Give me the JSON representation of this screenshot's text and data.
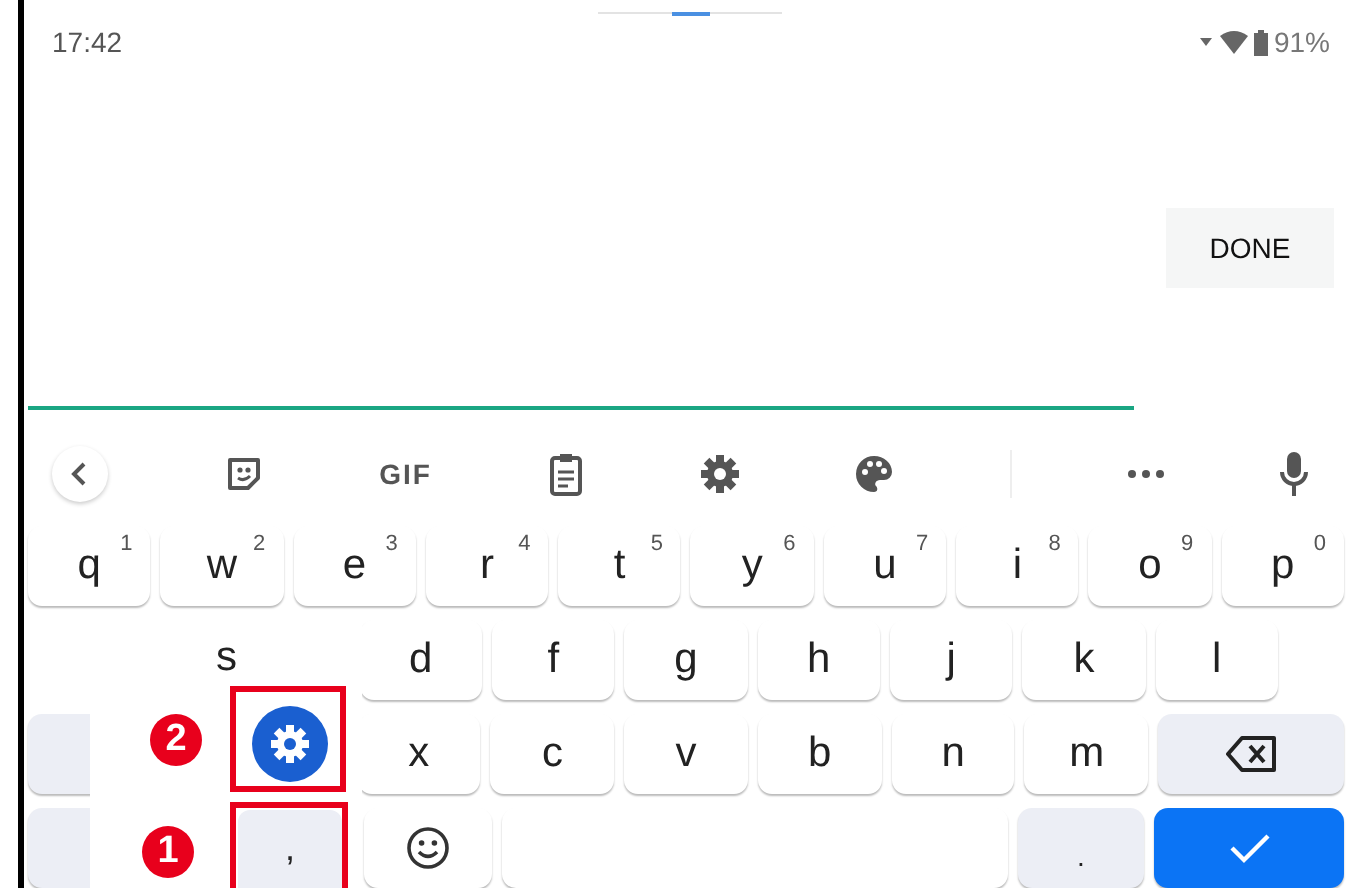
{
  "status_bar": {
    "time": "17:42",
    "battery": "91%"
  },
  "done_button": {
    "label": "DONE"
  },
  "suggestion_bar": [
    {
      "kind": "back"
    },
    {
      "kind": "sticker"
    },
    {
      "kind": "gif",
      "label": "GIF"
    },
    {
      "kind": "clipboard"
    },
    {
      "kind": "settings"
    },
    {
      "kind": "palette"
    },
    {
      "kind": "divider"
    },
    {
      "kind": "more"
    },
    {
      "kind": "mic"
    }
  ],
  "rows": [
    [
      {
        "kind": "letter",
        "label": "q",
        "hint": "1"
      },
      {
        "kind": "letter",
        "label": "w",
        "hint": "2"
      },
      {
        "kind": "letter",
        "label": "e",
        "hint": "3"
      },
      {
        "kind": "letter",
        "label": "r",
        "hint": "4"
      },
      {
        "kind": "letter",
        "label": "t",
        "hint": "5"
      },
      {
        "kind": "letter",
        "label": "y",
        "hint": "6"
      },
      {
        "kind": "letter",
        "label": "u",
        "hint": "7"
      },
      {
        "kind": "letter",
        "label": "i",
        "hint": "8"
      },
      {
        "kind": "letter",
        "label": "o",
        "hint": "9"
      },
      {
        "kind": "letter",
        "label": "p",
        "hint": "0"
      }
    ],
    [
      {
        "kind": "hidden"
      },
      {
        "kind": "hidden"
      },
      {
        "kind": "letter",
        "label": "d"
      },
      {
        "kind": "letter",
        "label": "f"
      },
      {
        "kind": "letter",
        "label": "g"
      },
      {
        "kind": "letter",
        "label": "h"
      },
      {
        "kind": "letter",
        "label": "j"
      },
      {
        "kind": "letter",
        "label": "k"
      },
      {
        "kind": "letter",
        "label": "l"
      }
    ],
    [
      {
        "kind": "function"
      },
      {
        "kind": "hidden"
      },
      {
        "kind": "letter",
        "label": "x"
      },
      {
        "kind": "letter",
        "label": "c"
      },
      {
        "kind": "letter",
        "label": "v"
      },
      {
        "kind": "letter",
        "label": "b"
      },
      {
        "kind": "letter",
        "label": "n"
      },
      {
        "kind": "letter",
        "label": "m"
      },
      {
        "kind": "backspace"
      }
    ],
    [
      {
        "kind": "function"
      },
      {
        "kind": "hidden"
      },
      {
        "kind": "emoji"
      },
      {
        "kind": "space"
      },
      {
        "kind": "period",
        "label": "."
      },
      {
        "kind": "enter"
      }
    ]
  ],
  "popup": {
    "letter": "s",
    "comma": ","
  },
  "annotations": [
    {
      "number": "2"
    },
    {
      "number": "1"
    }
  ]
}
